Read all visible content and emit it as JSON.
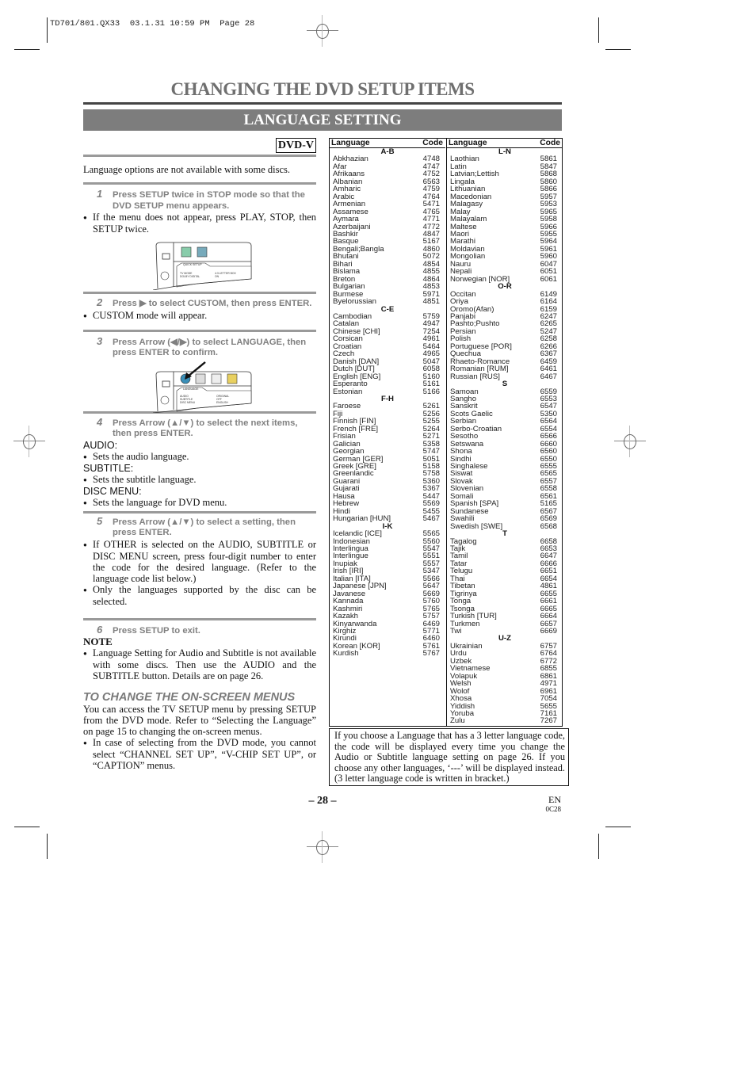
{
  "slug": "TD701/801.QX33  03.1.31 10:59 PM  Page 28",
  "title": "CHANGING THE DVD SETUP ITEMS",
  "banner": "LANGUAGE SETTING",
  "badge": "DVD-V",
  "intro": "Language options are not available with some discs.",
  "steps": {
    "s1": {
      "num": "1",
      "text": "Press SETUP twice in STOP mode so that the DVD SETUP menu appears."
    },
    "s1_bullet": "If the menu does not appear, press PLAY, STOP, then SETUP twice.",
    "s2": {
      "num": "2",
      "text": "Press ▶ to select CUSTOM, then press ENTER."
    },
    "s2_bullet": "CUSTOM mode will appear.",
    "s3": {
      "num": "3",
      "text": "Press Arrow (◀/▶) to select LANGUAGE, then press ENTER to confirm."
    },
    "s4": {
      "num": "4",
      "text": "Press Arrow (▲/▼) to select the next items, then press ENTER."
    },
    "audio_label": "AUDIO:",
    "audio_bullet": "Sets the audio language.",
    "subtitle_label": "SUBTITLE:",
    "subtitle_bullet": "Sets the subtitle language.",
    "discmenu_label": "DISC MENU:",
    "discmenu_bullet": "Sets the language for DVD menu.",
    "s5": {
      "num": "5",
      "text": "Press Arrow (▲/▼) to select a setting, then press ENTER."
    },
    "s5_bullet1": "If OTHER is selected on the AUDIO, SUBTITLE or DISC MENU screen, press four-digit number to enter the code for the desired language. (Refer to the language code list below.)",
    "s5_bullet2": "Only the languages supported by the disc can be selected.",
    "s6": {
      "num": "6",
      "text": "Press SETUP to exit."
    }
  },
  "screen1": {
    "tab": "QUICK SETUP",
    "row1_label": "TV MODE",
    "row1_value": "4:3 LETTER BOX",
    "row2_label": "DOLBY DIGITAL",
    "row2_value": "ON"
  },
  "screen2": {
    "tab": "LANGUAGE",
    "row1_label": "AUDIO",
    "row1_value": "ORIGINAL",
    "row2_label": "SUBTITLE",
    "row2_value": "OFF",
    "row3_label": "DISC MENU",
    "row3_value": "ENGLISH"
  },
  "note": {
    "label": "NOTE",
    "bullet": "Language Setting for Audio and Subtitle is not available with some discs. Then use the AUDIO and the SUBTITLE button. Details are on page 26."
  },
  "onscreen": {
    "heading": "TO CHANGE THE ON-SCREEN MENUS",
    "para": "You can access the TV SETUP menu by pressing SETUP from the DVD mode. Refer to “Selecting the Language” on page 15 to changing the on-screen menus.",
    "bullet": "In case of selecting from the DVD mode, you cannot select “CHANNEL SET UP”, “V-CHIP SET UP”, or “CAPTION” menus."
  },
  "table": {
    "header_language": "Language",
    "header_code": "Code",
    "columns": [
      [
        {
          "group": "A-B",
          "rows": [
            [
              "Abkhazian",
              "4748"
            ],
            [
              "Afar",
              "4747"
            ],
            [
              "Afrikaans",
              "4752"
            ],
            [
              "Albanian",
              "6563"
            ],
            [
              "Amharic",
              "4759"
            ],
            [
              "Arabic",
              "4764"
            ],
            [
              "Armenian",
              "5471"
            ],
            [
              "Assamese",
              "4765"
            ],
            [
              "Aymara",
              "4771"
            ],
            [
              "Azerbaijani",
              "4772"
            ],
            [
              "Bashkir",
              "4847"
            ],
            [
              "Basque",
              "5167"
            ],
            [
              "Bengali;Bangla",
              "4860"
            ],
            [
              "Bhutani",
              "5072"
            ],
            [
              "Bihari",
              "4854"
            ],
            [
              "Bislama",
              "4855"
            ],
            [
              "Breton",
              "4864"
            ],
            [
              "Bulgarian",
              "4853"
            ],
            [
              "Burmese",
              "5971"
            ],
            [
              "Byelorussian",
              "4851"
            ]
          ]
        },
        {
          "group": "C-E",
          "rows": [
            [
              "Cambodian",
              "5759"
            ],
            [
              "Catalan",
              "4947"
            ],
            [
              "Chinese [CHI]",
              "7254"
            ],
            [
              "Corsican",
              "4961"
            ],
            [
              "Croatian",
              "5464"
            ],
            [
              "Czech",
              "4965"
            ],
            [
              "Danish [DAN]",
              "5047"
            ],
            [
              "Dutch [DUT]",
              "6058"
            ],
            [
              "English [ENG]",
              "5160"
            ],
            [
              "Esperanto",
              "5161"
            ],
            [
              "Estonian",
              "5166"
            ]
          ]
        },
        {
          "group": "F-H",
          "rows": [
            [
              "Faroese",
              "5261"
            ],
            [
              "Fiji",
              "5256"
            ],
            [
              "Finnish [FIN]",
              "5255"
            ],
            [
              "French [FRE]",
              "5264"
            ],
            [
              "Frisian",
              "5271"
            ],
            [
              "Galician",
              "5358"
            ],
            [
              "Georgian",
              "5747"
            ],
            [
              "German [GER]",
              "5051"
            ],
            [
              "Greek [GRE]",
              "5158"
            ],
            [
              "Greenlandic",
              "5758"
            ],
            [
              "Guarani",
              "5360"
            ],
            [
              "Gujarati",
              "5367"
            ],
            [
              "Hausa",
              "5447"
            ],
            [
              "Hebrew",
              "5569"
            ],
            [
              "Hindi",
              "5455"
            ],
            [
              "Hungarian [HUN]",
              "5467"
            ]
          ]
        },
        {
          "group": "I-K",
          "rows": [
            [
              "Icelandic [ICE]",
              "5565"
            ],
            [
              "Indonesian",
              "5560"
            ],
            [
              "Interlingua",
              "5547"
            ],
            [
              "Interlingue",
              "5551"
            ],
            [
              "Inupiak",
              "5557"
            ],
            [
              "Irish [IRI]",
              "5347"
            ],
            [
              "Italian [ITA]",
              "5566"
            ],
            [
              "Japanese [JPN]",
              "5647"
            ],
            [
              "Javanese",
              "5669"
            ],
            [
              "Kannada",
              "5760"
            ],
            [
              "Kashmiri",
              "5765"
            ],
            [
              "Kazakh",
              "5757"
            ],
            [
              "Kinyarwanda",
              "6469"
            ],
            [
              "Kirghiz",
              "5771"
            ],
            [
              "Kirundi",
              "6460"
            ],
            [
              "Korean [KOR]",
              "5761"
            ],
            [
              "Kurdish",
              "5767"
            ]
          ]
        }
      ],
      [
        {
          "group": "L-N",
          "rows": [
            [
              "Laothian",
              "5861"
            ],
            [
              "Latin",
              "5847"
            ],
            [
              "Latvian;Lettish",
              "5868"
            ],
            [
              "Lingala",
              "5860"
            ],
            [
              "Lithuanian",
              "5866"
            ],
            [
              "Macedonian",
              "5957"
            ],
            [
              "Malagasy",
              "5953"
            ],
            [
              "Malay",
              "5965"
            ],
            [
              "Malayalam",
              "5958"
            ],
            [
              "Maltese",
              "5966"
            ],
            [
              "Maori",
              "5955"
            ],
            [
              "Marathi",
              "5964"
            ],
            [
              "Moldavian",
              "5961"
            ],
            [
              "Mongolian",
              "5960"
            ],
            [
              "Nauru",
              "6047"
            ],
            [
              "Nepali",
              "6051"
            ],
            [
              "Norwegian [NOR]",
              "6061"
            ]
          ]
        },
        {
          "group": "O-R",
          "rows": [
            [
              "Occitan",
              "6149"
            ],
            [
              "Oriya",
              "6164"
            ],
            [
              "Oromo(Afan)",
              "6159"
            ],
            [
              "Panjabi",
              "6247"
            ],
            [
              "Pashto;Pushto",
              "6265"
            ],
            [
              "Persian",
              "5247"
            ],
            [
              "Polish",
              "6258"
            ],
            [
              "Portuguese [POR]",
              "6266"
            ],
            [
              "Quechua",
              "6367"
            ],
            [
              "Rhaeto-Romance",
              "6459"
            ],
            [
              "Romanian [RUM]",
              "6461"
            ],
            [
              "Russian [RUS]",
              "6467"
            ]
          ]
        },
        {
          "group": "S",
          "rows": [
            [
              "Samoan",
              "6559"
            ],
            [
              "Sangho",
              "6553"
            ],
            [
              "Sanskrit",
              "6547"
            ],
            [
              "Scots Gaelic",
              "5350"
            ],
            [
              "Serbian",
              "6564"
            ],
            [
              "Serbo-Croatian",
              "6554"
            ],
            [
              "Sesotho",
              "6566"
            ],
            [
              "Setswana",
              "6660"
            ],
            [
              "Shona",
              "6560"
            ],
            [
              "Sindhi",
              "6550"
            ],
            [
              "Singhalese",
              "6555"
            ],
            [
              "Siswat",
              "6565"
            ],
            [
              "Slovak",
              "6557"
            ],
            [
              "Slovenian",
              "6558"
            ],
            [
              "Somali",
              "6561"
            ],
            [
              "Spanish [SPA]",
              "5165"
            ],
            [
              "Sundanese",
              "6567"
            ],
            [
              "Swahili",
              "6569"
            ],
            [
              "Swedish [SWE]",
              "6568"
            ]
          ]
        },
        {
          "group": "T",
          "rows": [
            [
              "Tagalog",
              "6658"
            ],
            [
              "Tajik",
              "6653"
            ],
            [
              "Tamil",
              "6647"
            ],
            [
              "Tatar",
              "6666"
            ],
            [
              "Telugu",
              "6651"
            ],
            [
              "Thai",
              "6654"
            ],
            [
              "Tibetan",
              "4861"
            ],
            [
              "Tigrinya",
              "6655"
            ],
            [
              "Tonga",
              "6661"
            ],
            [
              "Tsonga",
              "6665"
            ],
            [
              "Turkish [TUR]",
              "6664"
            ],
            [
              "Turkmen",
              "6657"
            ],
            [
              "Twi",
              "6669"
            ]
          ]
        },
        {
          "group": "U-Z",
          "rows": [
            [
              "Ukrainian",
              "6757"
            ],
            [
              "Urdu",
              "6764"
            ],
            [
              "Uzbek",
              "6772"
            ],
            [
              "Vietnamese",
              "6855"
            ],
            [
              "Volapuk",
              "6861"
            ],
            [
              "Welsh",
              "4971"
            ],
            [
              "Wolof",
              "6961"
            ],
            [
              "Xhosa",
              "7054"
            ],
            [
              "Yiddish",
              "5655"
            ],
            [
              "Yoruba",
              "7161"
            ],
            [
              "Zulu",
              "7267"
            ]
          ]
        }
      ]
    ]
  },
  "infobox": "If you choose a Language that has a 3 letter language code, the code will be displayed every time you change the Audio or Subtitle language setting on page 26. If you choose any other languages, ‘---’ will be displayed instead. (3 letter language code is written in bracket.)",
  "footer": {
    "page": "– 28 –",
    "lang": "EN",
    "code": "0C28"
  },
  "icons": {
    "screen_icons_step3": [
      "globe-icon",
      "display-icon",
      "speaker-icon",
      "lock-icon"
    ],
    "pointer": "arrow-pointer-icon"
  }
}
